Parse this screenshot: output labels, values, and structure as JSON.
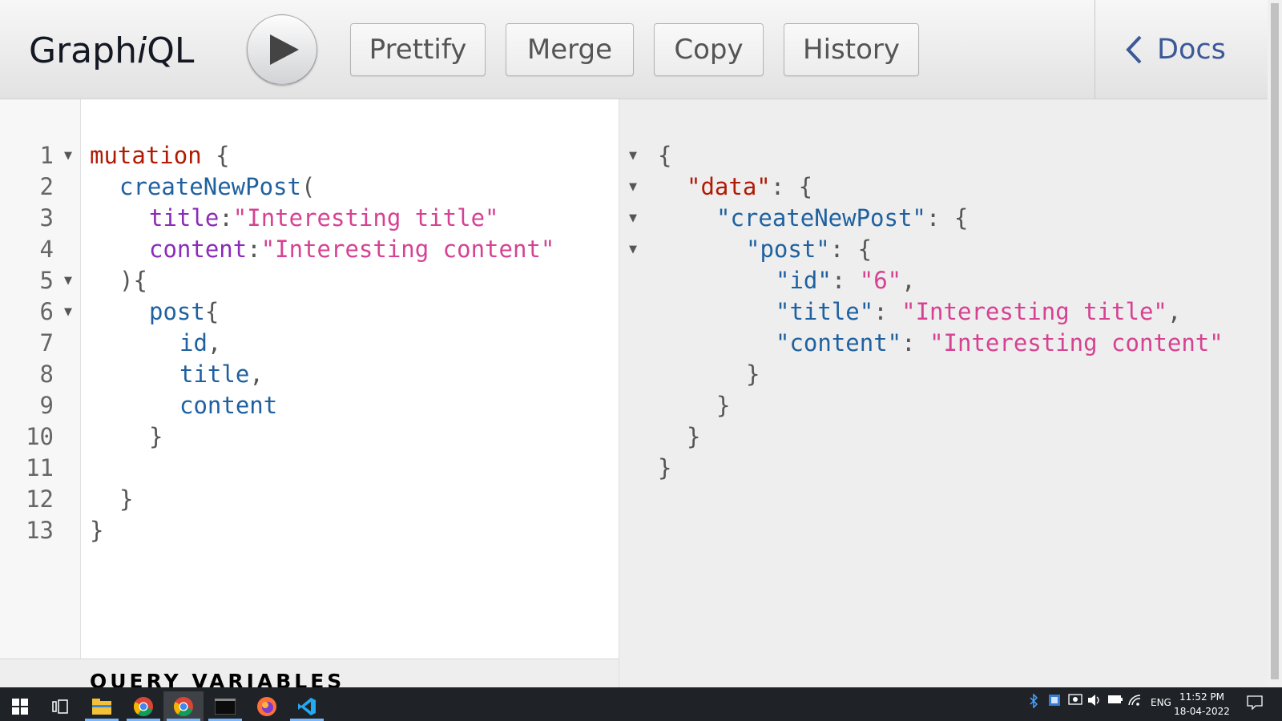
{
  "app": {
    "title_prefix": "Graph",
    "title_italic": "i",
    "title_suffix": "QL"
  },
  "toolbar": {
    "run_label": "",
    "buttons": [
      "Prettify",
      "Merge",
      "Copy",
      "History"
    ],
    "docs_label": "Docs"
  },
  "editor": {
    "line_numbers": [
      "1",
      "2",
      "3",
      "4",
      "5",
      "6",
      "7",
      "8",
      "9",
      "10",
      "11",
      "12",
      "13"
    ],
    "query": {
      "keyword": "mutation",
      "open_brace": " {",
      "field": "createNewPost",
      "open_paren": "(",
      "arg1_name": "title",
      "arg1_value": "\"Interesting title\"",
      "arg2_name": "content",
      "arg2_value": "\"Interesting content\"",
      "close_paren": "){",
      "sub_field": "post",
      "sub_open": "{",
      "f1": "id",
      "f2": "title",
      "f3": "content",
      "comma": ",",
      "colon": ":",
      "close_brace": "}"
    }
  },
  "variables": {
    "title": "QUERY VARIABLES"
  },
  "result": {
    "open": "{",
    "data_key": "\"data\"",
    "create_key": "\"createNewPost\"",
    "post_key": "\"post\"",
    "id_key": "\"id\"",
    "id_value": "\"6\"",
    "title_key": "\"title\"",
    "title_value": "\"Interesting title\"",
    "content_key": "\"content\"",
    "content_value": "\"Interesting content\"",
    "sep": ": ",
    "obj_open": ": {",
    "comma": ",",
    "close": "}"
  },
  "taskbar": {
    "language": "ENG",
    "time": "11:52 PM",
    "date": "18-04-2022"
  }
}
